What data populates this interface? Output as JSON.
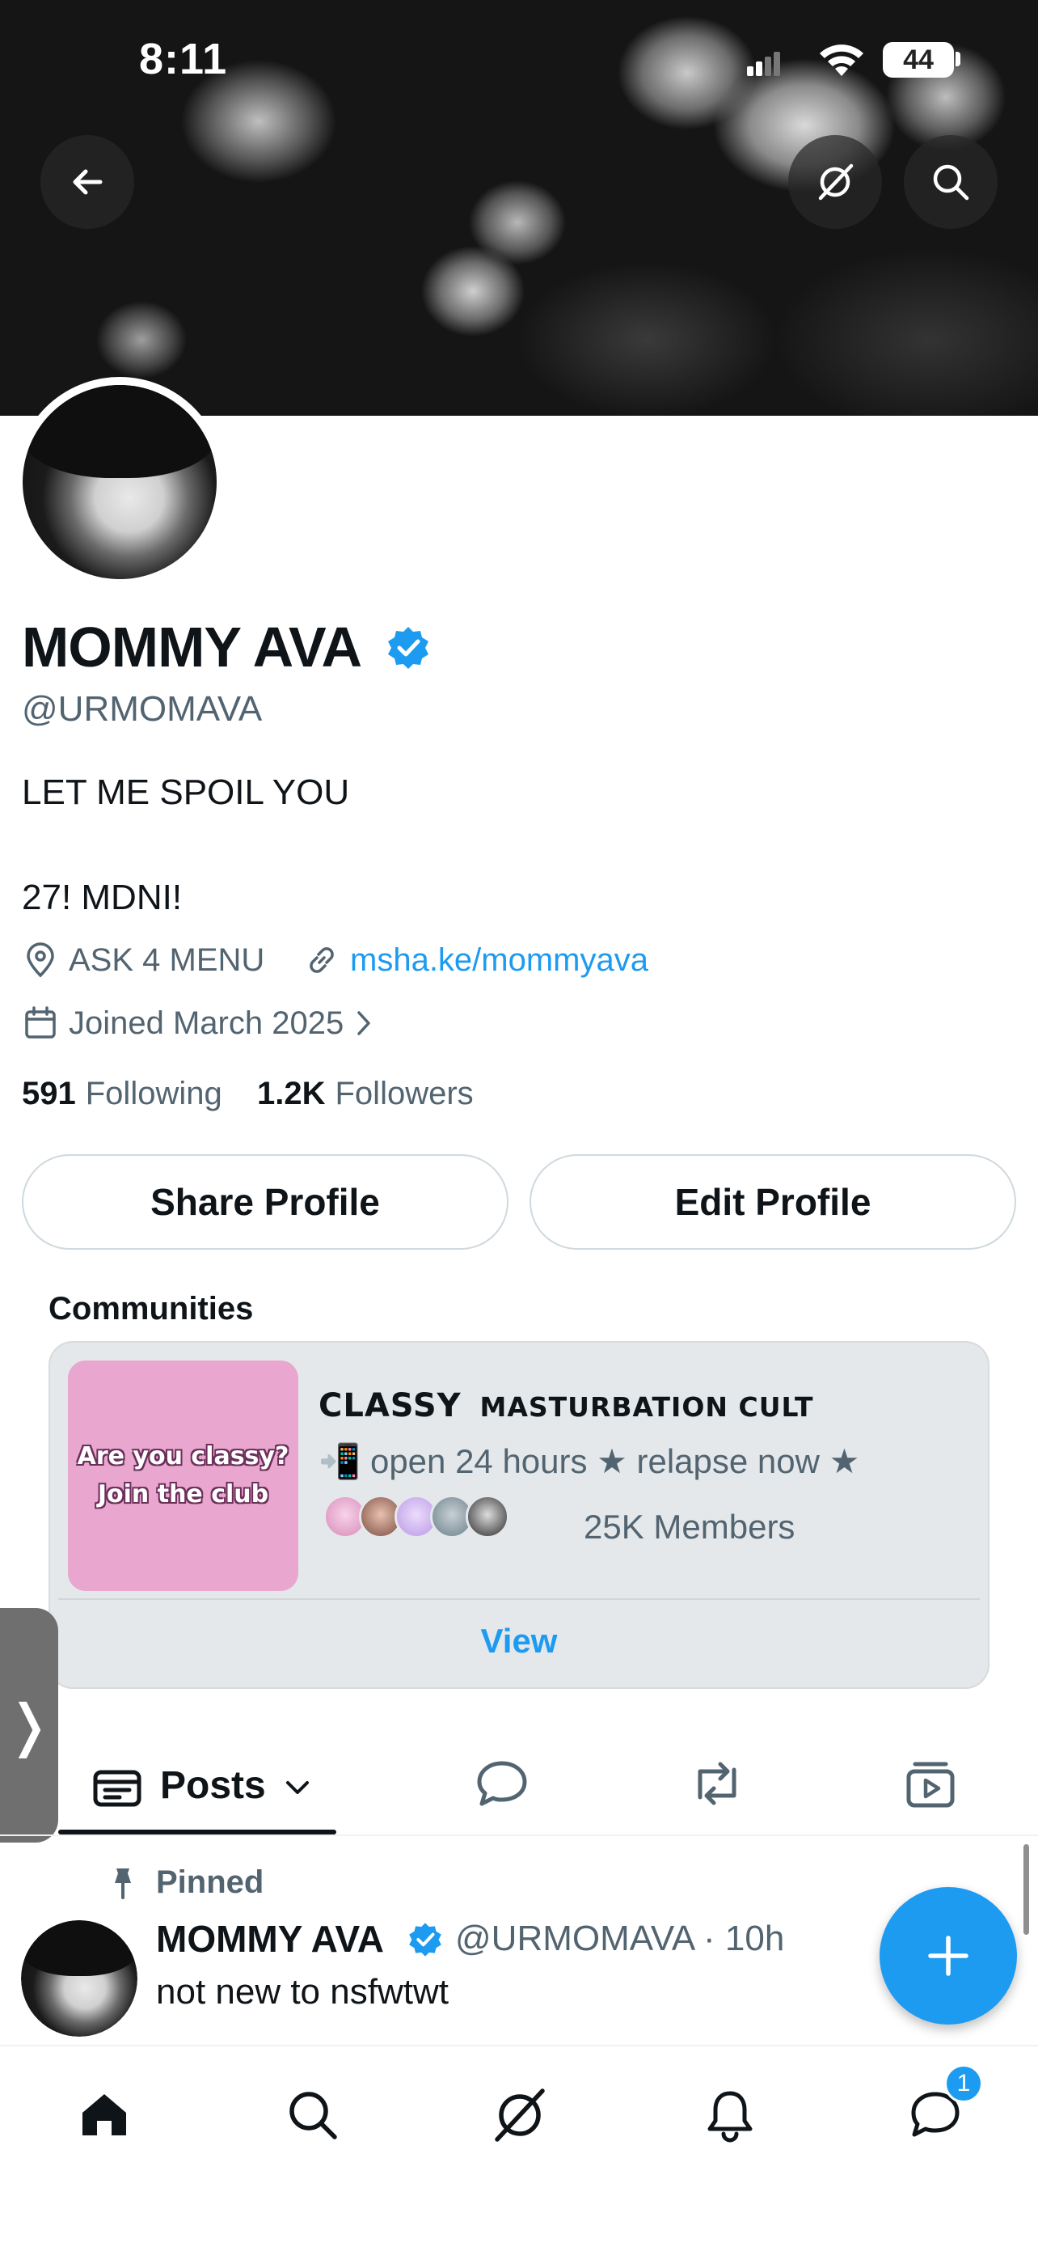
{
  "status_bar": {
    "time": "8:11",
    "battery": "44"
  },
  "header": {
    "back_icon": "arrow-left-icon",
    "grok_icon": "grok-icon",
    "search_icon": "search-icon"
  },
  "profile": {
    "name": "MOMMY AVA",
    "handle": "@URMOMAVA",
    "bio_line1": "LET ME SPOIL YOU",
    "bio_line2": "27! MDNI!",
    "location": "ASK 4 MENU",
    "link": "msha.ke/mommyava",
    "joined": "Joined March 2025",
    "following_count": "591",
    "following_label": "Following",
    "followers_count": "1.2K",
    "followers_label": "Followers"
  },
  "actions": {
    "share": "Share Profile",
    "edit": "Edit Profile"
  },
  "communities": {
    "section_title": "Communities",
    "thumb_line1": "Are you classy?",
    "thumb_line2": "Join the club",
    "name_big": "CLASSY",
    "name_small": "MASTURBATION CULT",
    "description": "📲 open 24 hours ★ relapse now ★",
    "members": "25K Members",
    "view": "View"
  },
  "tabs": {
    "posts_label": "Posts",
    "side_handle": "❭"
  },
  "post": {
    "pinned_label": "Pinned",
    "author_name": "MOMMY AVA",
    "meta": "@URMOMAVA · 10h",
    "text": "not new to nsfwtwt"
  },
  "bottom_nav": {
    "dm_badge": "1"
  },
  "colors": {
    "accent": "#1d9bf0",
    "text": "#0f1419",
    "secondary": "#536471"
  }
}
